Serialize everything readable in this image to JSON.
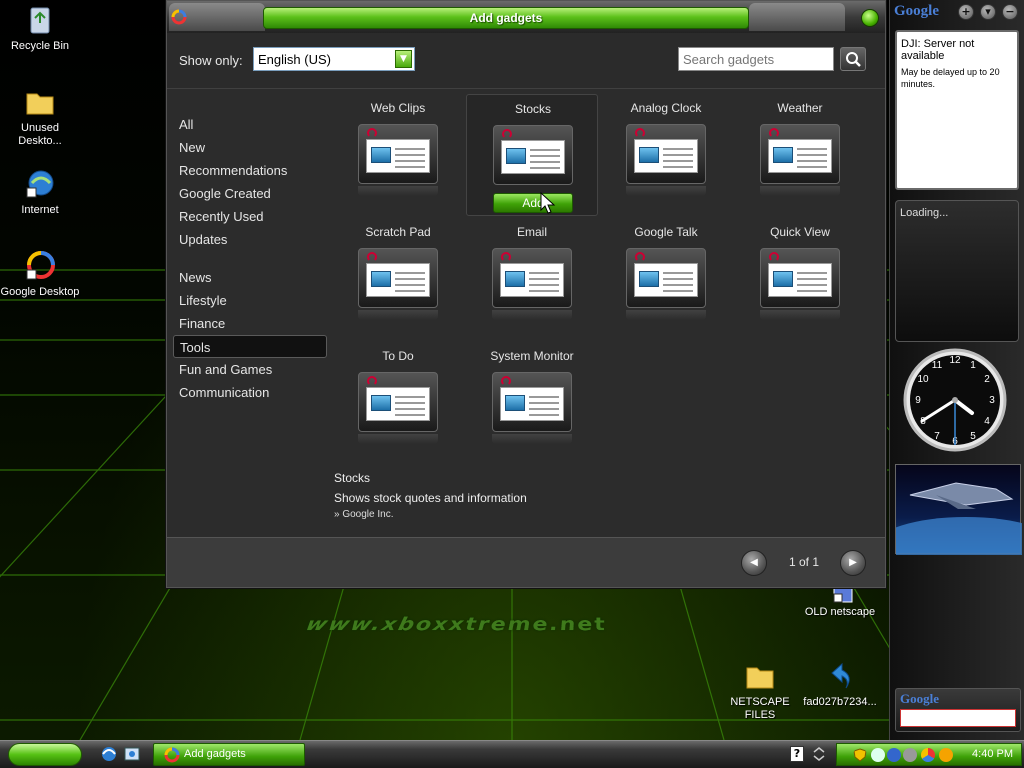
{
  "window": {
    "title": "Add gadgets",
    "show_only_label": "Show only:",
    "language_value": "English (US)",
    "search_placeholder": "Search gadgets"
  },
  "categories_primary": [
    "All",
    "New",
    "Recommendations",
    "Google Created",
    "Recently Used",
    "Updates"
  ],
  "categories_secondary": [
    "News",
    "Lifestyle",
    "Finance",
    "Tools",
    "Fun and Games",
    "Communication"
  ],
  "selected_category": "Tools",
  "gadgets": [
    {
      "name": "Web Clips"
    },
    {
      "name": "Stocks"
    },
    {
      "name": "Analog Clock"
    },
    {
      "name": "Weather"
    },
    {
      "name": "Scratch Pad"
    },
    {
      "name": "Email"
    },
    {
      "name": "Google Talk"
    },
    {
      "name": "Quick View"
    },
    {
      "name": "To Do"
    },
    {
      "name": "System Monitor"
    }
  ],
  "add_button_label": "Add",
  "details": {
    "name": "Stocks",
    "description": "Shows stock quotes and information",
    "author": "» Google Inc."
  },
  "pagination": {
    "indicator": "1 of 1"
  },
  "desktop_icons": [
    {
      "label": "Recycle Bin",
      "icon": "recycle-bin-icon"
    },
    {
      "label": "Unused Deskto...",
      "icon": "folder-icon"
    },
    {
      "label": "Internet",
      "icon": "internet-icon"
    },
    {
      "label": "Google Desktop",
      "icon": "google-desktop-icon"
    },
    {
      "label": "OLD netscape",
      "icon": "shortcut-icon"
    },
    {
      "label": "NETSCAPE FILES",
      "icon": "folder-icon"
    },
    {
      "label": "fad027b7234...",
      "icon": "blue-arrow-icon"
    }
  ],
  "watermark": "www.xboxxtreme.net",
  "sidebar": {
    "logo": "Google",
    "stocks_error": "DJI: Server not available",
    "stocks_note": "May be delayed up to 20 minutes.",
    "news_status": "Loading...",
    "search_logo": "Google",
    "clock_numbers": [
      "12",
      "1",
      "2",
      "3",
      "4",
      "5",
      "6",
      "7",
      "8",
      "9",
      "10",
      "11"
    ]
  },
  "taskbar": {
    "task_label": "Add gadgets",
    "clock": "4:40 PM",
    "help_glyph": "?"
  },
  "colors": {
    "accent_green": "#4aa90c",
    "window_bg": "#2c2c2c",
    "google_blue": "#4a7fd6"
  }
}
